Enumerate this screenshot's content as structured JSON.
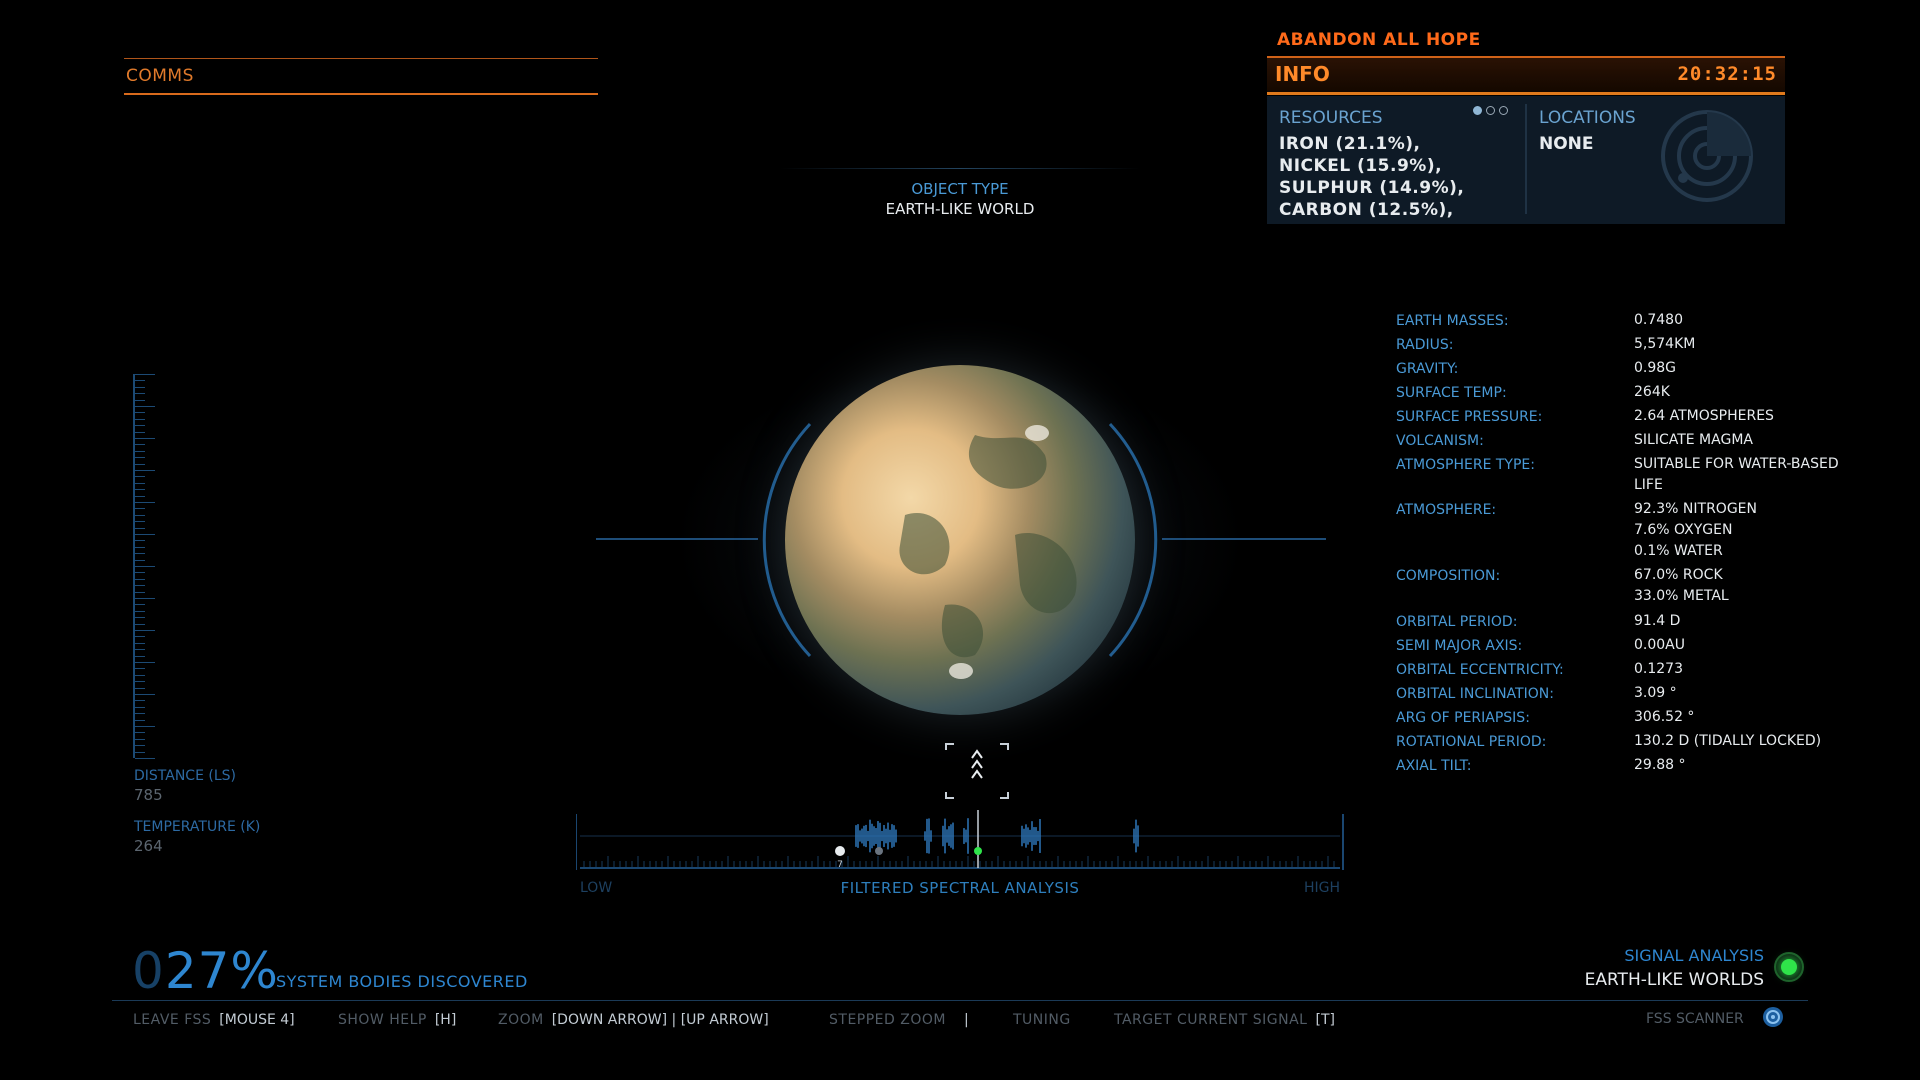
{
  "comms": {
    "label": "COMMS"
  },
  "info": {
    "ship_name": "ABANDON ALL HOPE",
    "label": "INFO",
    "time": "20:32:15",
    "resources_header": "RESOURCES",
    "resources": [
      "IRON (21.1%),",
      "NICKEL (15.9%),",
      "SULPHUR (14.9%),",
      "CARBON (12.5%),"
    ],
    "locations_header": "LOCATIONS",
    "locations_value": "NONE"
  },
  "object": {
    "type_label": "OBJECT TYPE",
    "type_value": "EARTH-LIKE WORLD"
  },
  "properties": {
    "earth_masses": {
      "k": "EARTH MASSES:",
      "v": "0.7480"
    },
    "radius": {
      "k": "RADIUS:",
      "v": "5,574KM"
    },
    "gravity": {
      "k": "GRAVITY:",
      "v": "0.98G"
    },
    "surface_temp": {
      "k": "SURFACE TEMP:",
      "v": "264K"
    },
    "surface_pressure": {
      "k": "SURFACE PRESSURE:",
      "v": "2.64 ATMOSPHERES"
    },
    "volcanism": {
      "k": "VOLCANISM:",
      "v": "SILICATE MAGMA"
    },
    "atmosphere_type": {
      "k": "ATMOSPHERE TYPE:",
      "v1": "SUITABLE FOR WATER-BASED",
      "v2": "LIFE"
    },
    "atmosphere": {
      "k": "ATMOSPHERE:",
      "v1": "92.3% NITROGEN",
      "v2": "7.6% OXYGEN",
      "v3": "0.1% WATER"
    },
    "composition": {
      "k": "COMPOSITION:",
      "v1": "67.0% ROCK",
      "v2": "33.0% METAL"
    },
    "orbital_period": {
      "k": "ORBITAL PERIOD:",
      "v": "91.4 D"
    },
    "semi_major_axis": {
      "k": "SEMI MAJOR AXIS:",
      "v": "0.00AU"
    },
    "orbital_eccentricity": {
      "k": "ORBITAL ECCENTRICITY:",
      "v": "0.1273"
    },
    "orbital_inclination": {
      "k": "ORBITAL INCLINATION:",
      "v": "3.09 °"
    },
    "arg_of_periapsis": {
      "k": "ARG OF PERIAPSIS:",
      "v": "306.52 °"
    },
    "rotational_period": {
      "k": "ROTATIONAL PERIOD:",
      "v": "130.2 D (TIDALLY LOCKED)"
    },
    "axial_tilt": {
      "k": "AXIAL TILT:",
      "v": "29.88 °"
    }
  },
  "left_readouts": {
    "distance_label": "DISTANCE (LS)",
    "distance_value": "785",
    "temperature_label": "TEMPERATURE (K)",
    "temperature_value": "264"
  },
  "spectral": {
    "low": "LOW",
    "high": "HIGH",
    "title": "FILTERED SPECTRAL ANALYSIS",
    "marker_number": "7"
  },
  "discovery": {
    "pct_zero": "0",
    "pct": "27%",
    "label": "SYSTEM BODIES DISCOVERED"
  },
  "help": [
    {
      "k": "LEAVE FSS",
      "v": "[MOUSE 4]"
    },
    {
      "k": "SHOW HELP",
      "v": "[H]"
    },
    {
      "k": "ZOOM",
      "v": "[DOWN ARROW] | [UP ARROW]"
    },
    {
      "k": "STEPPED ZOOM",
      "v": "|"
    },
    {
      "k": "TUNING",
      "v": ""
    },
    {
      "k": "TARGET CURRENT SIGNAL",
      "v": "[T]"
    }
  ],
  "signal": {
    "label": "SIGNAL ANALYSIS",
    "value": "EARTH-LIKE WORLDS"
  },
  "fss": {
    "label": "FSS SCANNER"
  },
  "colors": {
    "accent_orange": "#e07a2b",
    "accent_blue": "#2e86d0",
    "signal_green": "#2fe34a"
  }
}
